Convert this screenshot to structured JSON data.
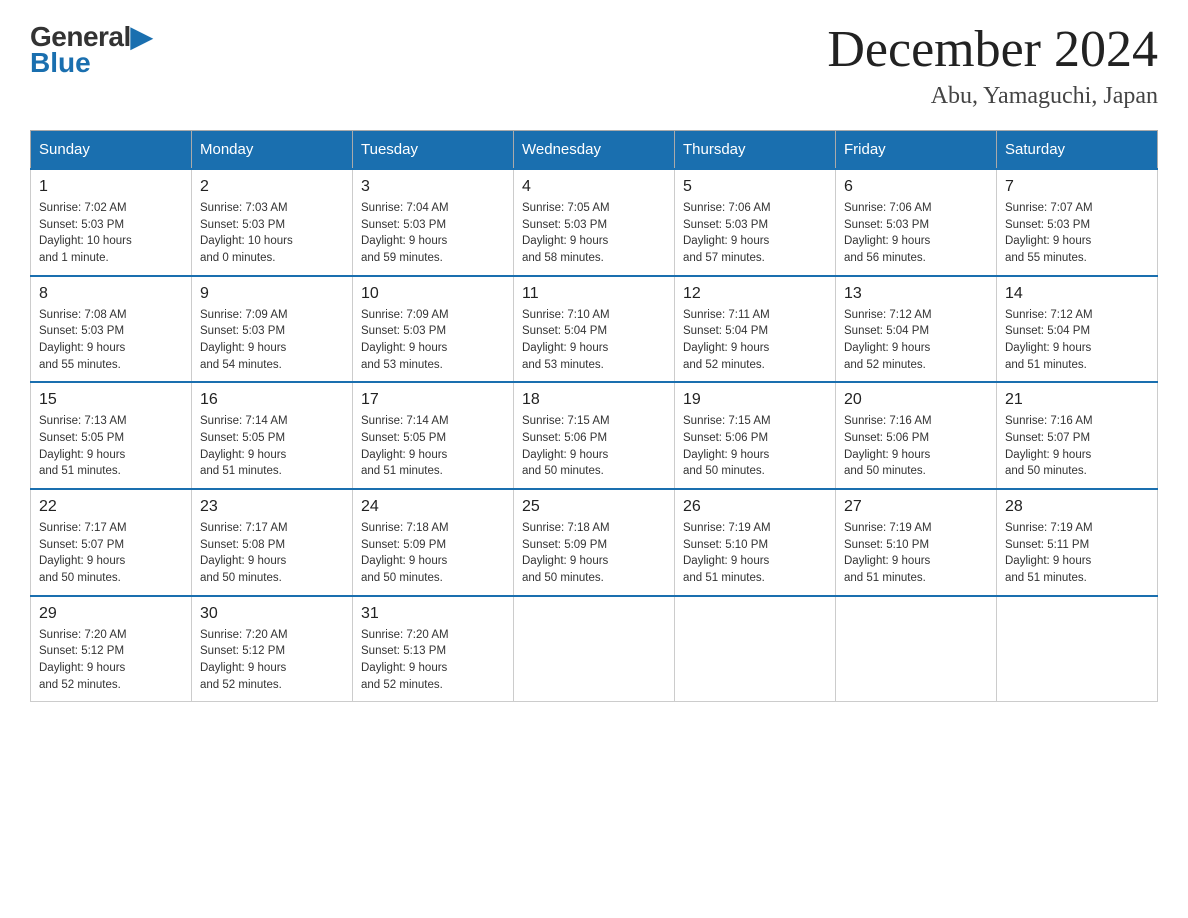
{
  "logo": {
    "general": "General",
    "blue": "Blue"
  },
  "title": "December 2024",
  "location": "Abu, Yamaguchi, Japan",
  "days_of_week": [
    "Sunday",
    "Monday",
    "Tuesday",
    "Wednesday",
    "Thursday",
    "Friday",
    "Saturday"
  ],
  "weeks": [
    [
      {
        "day": "1",
        "sunrise": "7:02 AM",
        "sunset": "5:03 PM",
        "daylight": "10 hours and 1 minute."
      },
      {
        "day": "2",
        "sunrise": "7:03 AM",
        "sunset": "5:03 PM",
        "daylight": "10 hours and 0 minutes."
      },
      {
        "day": "3",
        "sunrise": "7:04 AM",
        "sunset": "5:03 PM",
        "daylight": "9 hours and 59 minutes."
      },
      {
        "day": "4",
        "sunrise": "7:05 AM",
        "sunset": "5:03 PM",
        "daylight": "9 hours and 58 minutes."
      },
      {
        "day": "5",
        "sunrise": "7:06 AM",
        "sunset": "5:03 PM",
        "daylight": "9 hours and 57 minutes."
      },
      {
        "day": "6",
        "sunrise": "7:06 AM",
        "sunset": "5:03 PM",
        "daylight": "9 hours and 56 minutes."
      },
      {
        "day": "7",
        "sunrise": "7:07 AM",
        "sunset": "5:03 PM",
        "daylight": "9 hours and 55 minutes."
      }
    ],
    [
      {
        "day": "8",
        "sunrise": "7:08 AM",
        "sunset": "5:03 PM",
        "daylight": "9 hours and 55 minutes."
      },
      {
        "day": "9",
        "sunrise": "7:09 AM",
        "sunset": "5:03 PM",
        "daylight": "9 hours and 54 minutes."
      },
      {
        "day": "10",
        "sunrise": "7:09 AM",
        "sunset": "5:03 PM",
        "daylight": "9 hours and 53 minutes."
      },
      {
        "day": "11",
        "sunrise": "7:10 AM",
        "sunset": "5:04 PM",
        "daylight": "9 hours and 53 minutes."
      },
      {
        "day": "12",
        "sunrise": "7:11 AM",
        "sunset": "5:04 PM",
        "daylight": "9 hours and 52 minutes."
      },
      {
        "day": "13",
        "sunrise": "7:12 AM",
        "sunset": "5:04 PM",
        "daylight": "9 hours and 52 minutes."
      },
      {
        "day": "14",
        "sunrise": "7:12 AM",
        "sunset": "5:04 PM",
        "daylight": "9 hours and 51 minutes."
      }
    ],
    [
      {
        "day": "15",
        "sunrise": "7:13 AM",
        "sunset": "5:05 PM",
        "daylight": "9 hours and 51 minutes."
      },
      {
        "day": "16",
        "sunrise": "7:14 AM",
        "sunset": "5:05 PM",
        "daylight": "9 hours and 51 minutes."
      },
      {
        "day": "17",
        "sunrise": "7:14 AM",
        "sunset": "5:05 PM",
        "daylight": "9 hours and 51 minutes."
      },
      {
        "day": "18",
        "sunrise": "7:15 AM",
        "sunset": "5:06 PM",
        "daylight": "9 hours and 50 minutes."
      },
      {
        "day": "19",
        "sunrise": "7:15 AM",
        "sunset": "5:06 PM",
        "daylight": "9 hours and 50 minutes."
      },
      {
        "day": "20",
        "sunrise": "7:16 AM",
        "sunset": "5:06 PM",
        "daylight": "9 hours and 50 minutes."
      },
      {
        "day": "21",
        "sunrise": "7:16 AM",
        "sunset": "5:07 PM",
        "daylight": "9 hours and 50 minutes."
      }
    ],
    [
      {
        "day": "22",
        "sunrise": "7:17 AM",
        "sunset": "5:07 PM",
        "daylight": "9 hours and 50 minutes."
      },
      {
        "day": "23",
        "sunrise": "7:17 AM",
        "sunset": "5:08 PM",
        "daylight": "9 hours and 50 minutes."
      },
      {
        "day": "24",
        "sunrise": "7:18 AM",
        "sunset": "5:09 PM",
        "daylight": "9 hours and 50 minutes."
      },
      {
        "day": "25",
        "sunrise": "7:18 AM",
        "sunset": "5:09 PM",
        "daylight": "9 hours and 50 minutes."
      },
      {
        "day": "26",
        "sunrise": "7:19 AM",
        "sunset": "5:10 PM",
        "daylight": "9 hours and 51 minutes."
      },
      {
        "day": "27",
        "sunrise": "7:19 AM",
        "sunset": "5:10 PM",
        "daylight": "9 hours and 51 minutes."
      },
      {
        "day": "28",
        "sunrise": "7:19 AM",
        "sunset": "5:11 PM",
        "daylight": "9 hours and 51 minutes."
      }
    ],
    [
      {
        "day": "29",
        "sunrise": "7:20 AM",
        "sunset": "5:12 PM",
        "daylight": "9 hours and 52 minutes."
      },
      {
        "day": "30",
        "sunrise": "7:20 AM",
        "sunset": "5:12 PM",
        "daylight": "9 hours and 52 minutes."
      },
      {
        "day": "31",
        "sunrise": "7:20 AM",
        "sunset": "5:13 PM",
        "daylight": "9 hours and 52 minutes."
      },
      null,
      null,
      null,
      null
    ]
  ]
}
